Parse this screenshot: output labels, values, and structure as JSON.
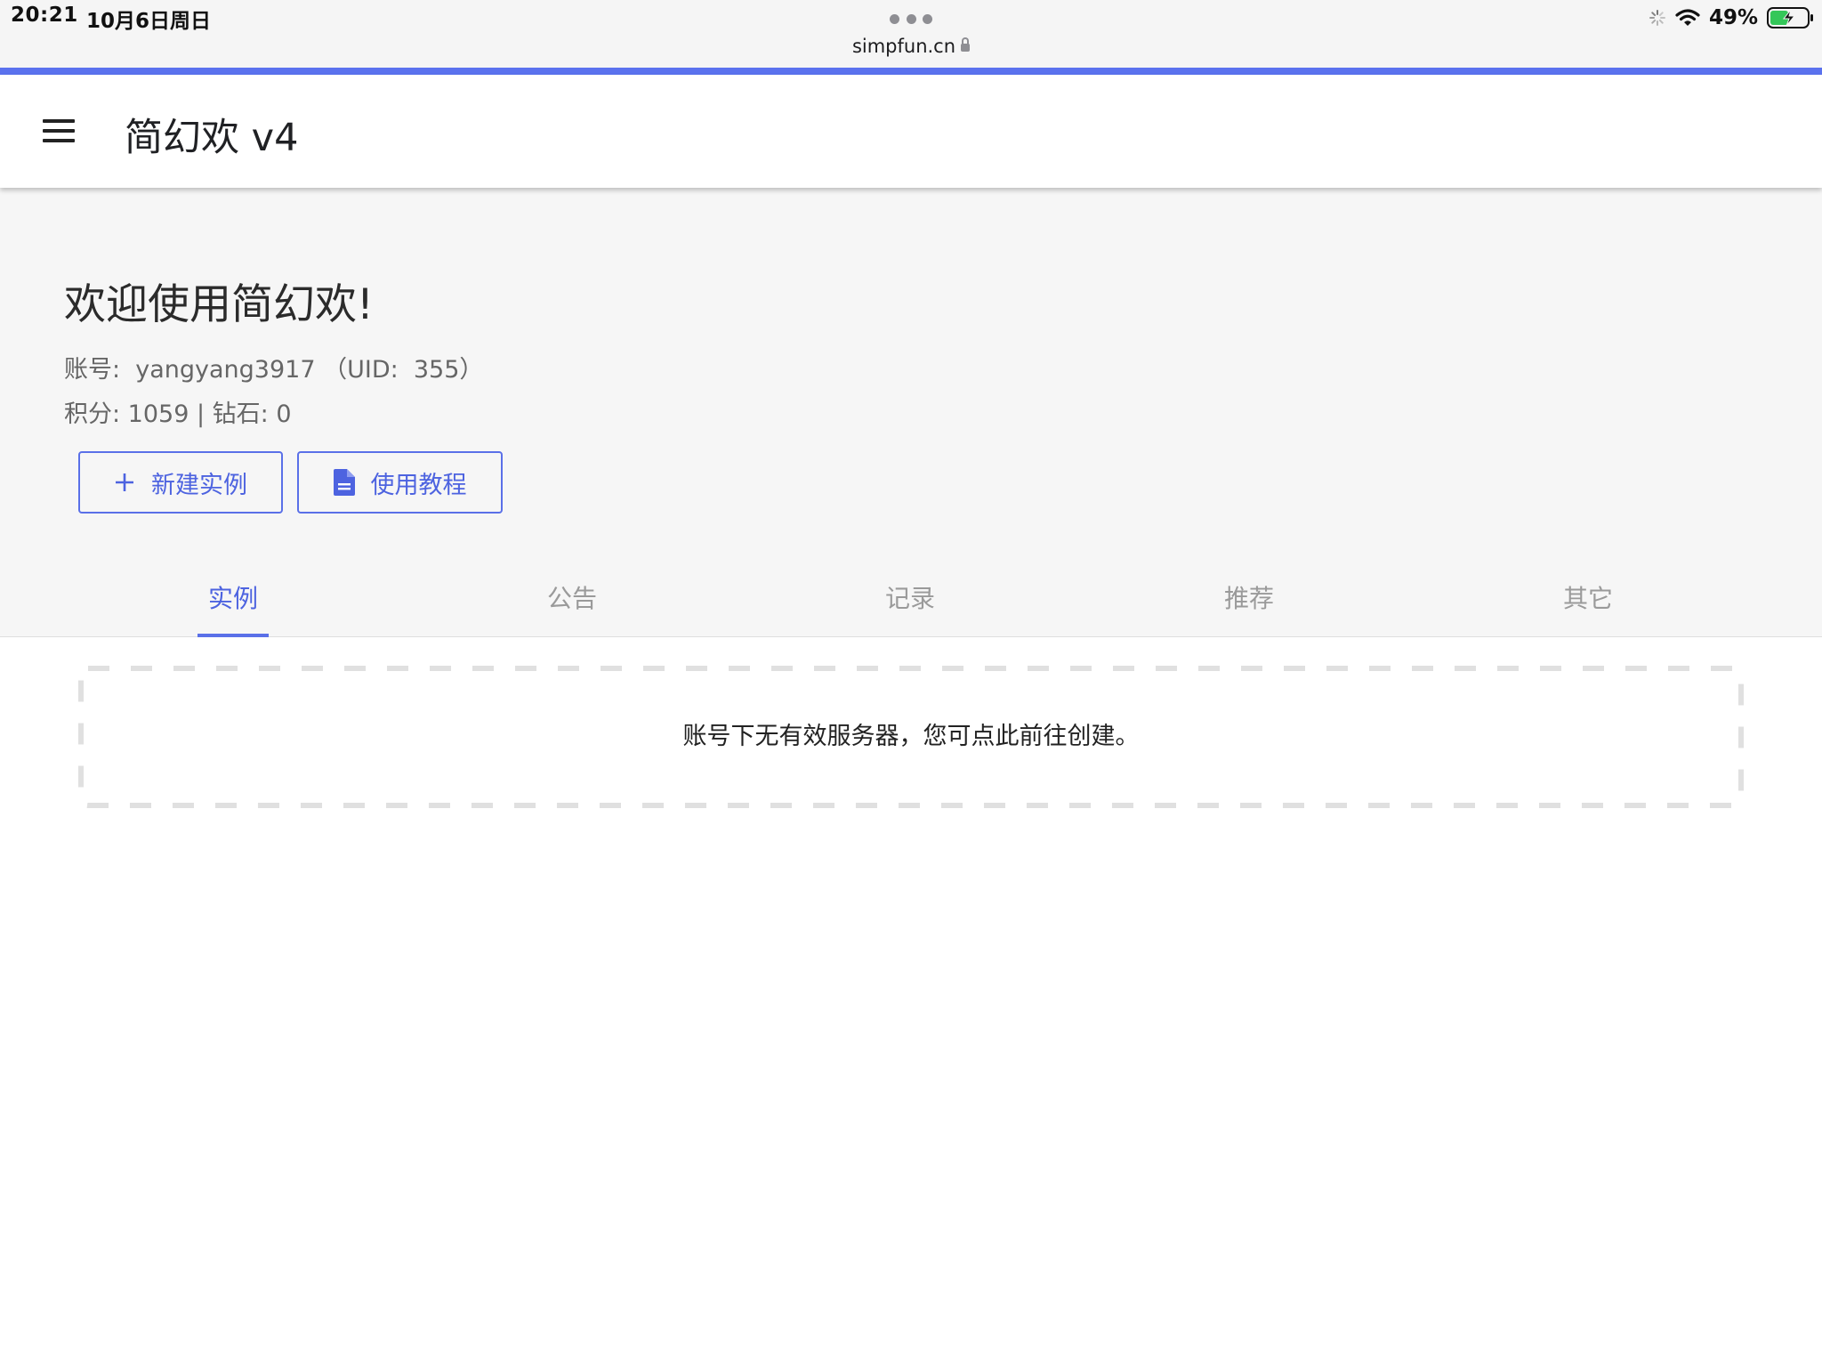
{
  "status_bar": {
    "time": "20:21",
    "date": "10月6日周日",
    "url": "simpfun.cn",
    "battery": "49%"
  },
  "app_bar": {
    "title": "简幻欢 v4"
  },
  "header": {
    "welcome": "欢迎使用简幻欢!",
    "account_line": "账号:  yangyang3917 （UID:  355）",
    "points_line": "积分: 1059 | 钻石: 0"
  },
  "buttons": {
    "new_instance": "新建实例",
    "tutorial": "使用教程"
  },
  "tabs": [
    {
      "label": "实例",
      "active": true
    },
    {
      "label": "公告",
      "active": false
    },
    {
      "label": "记录",
      "active": false
    },
    {
      "label": "推荐",
      "active": false
    },
    {
      "label": "其它",
      "active": false
    }
  ],
  "empty_state": {
    "message": "账号下无有效服务器，您可点此前往创建。"
  },
  "colors": {
    "accent": "#5b72ee",
    "header_bg": "#f6f6f6",
    "battery_green": "#34c759"
  },
  "icons": [
    "menu-icon",
    "plus-icon",
    "document-icon",
    "lock-icon",
    "wifi-icon",
    "battery-icon",
    "loading-icon"
  ]
}
